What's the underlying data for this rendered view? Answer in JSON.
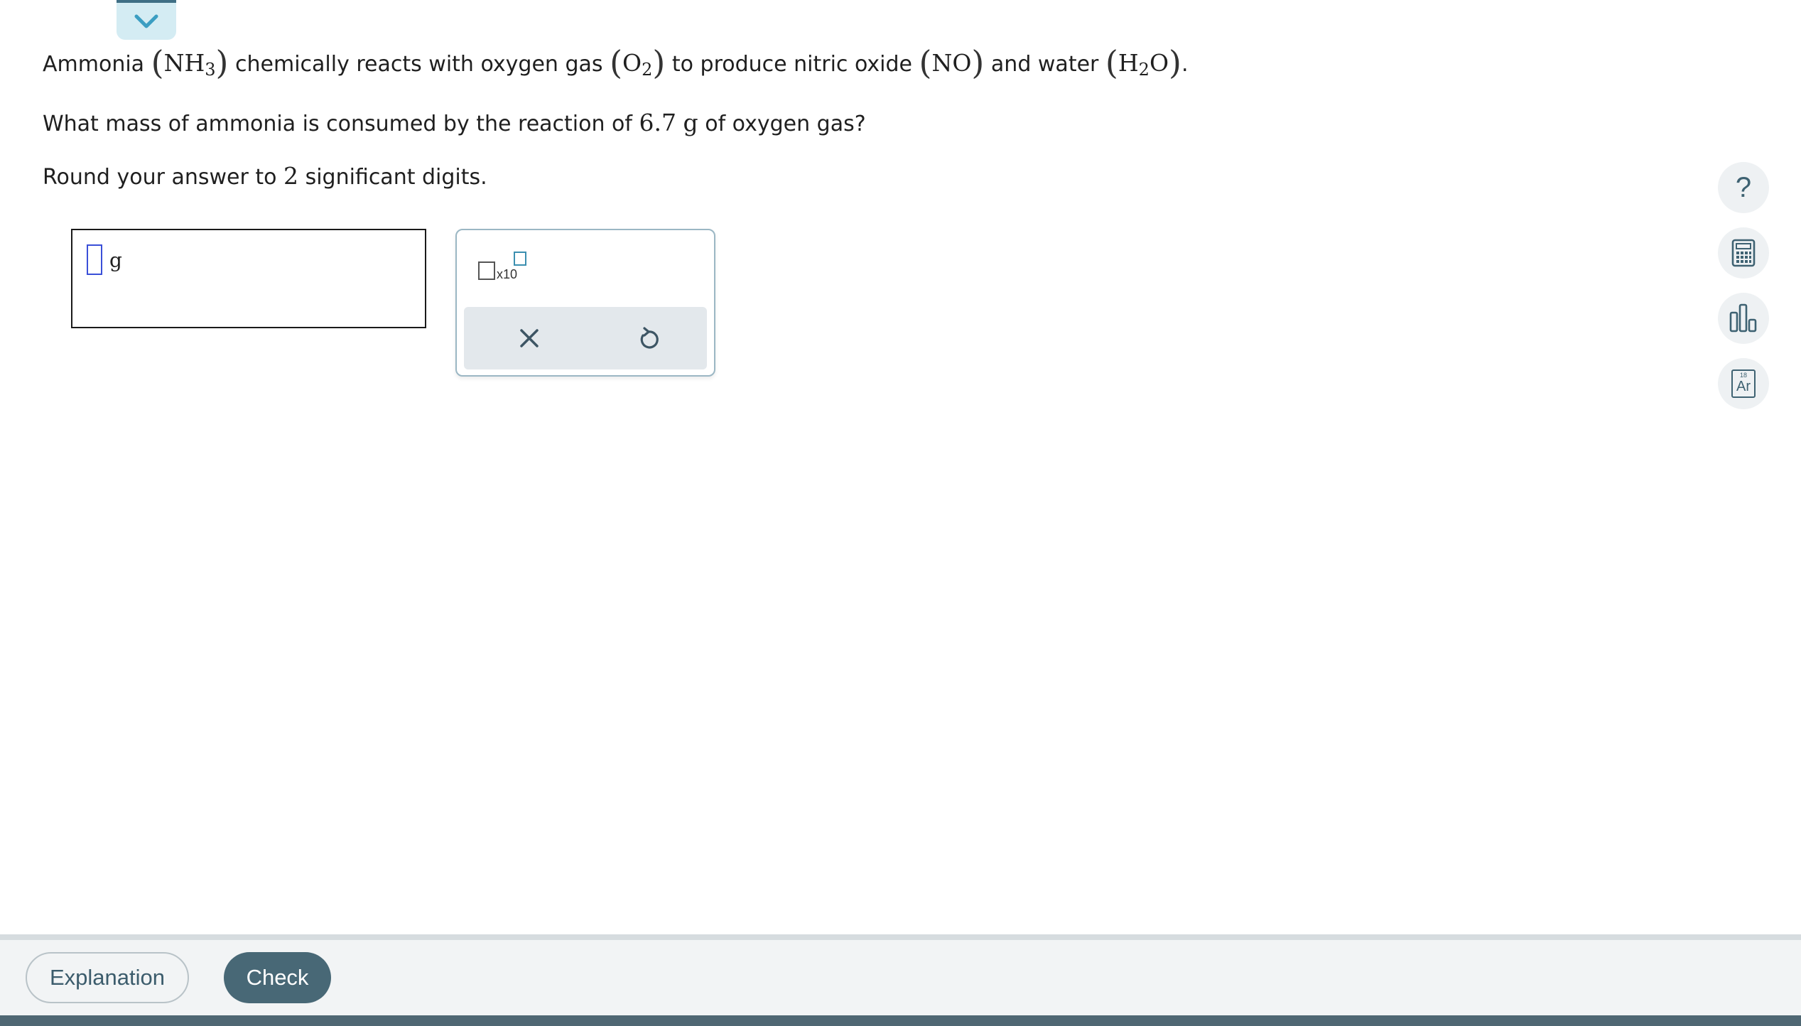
{
  "question": {
    "line1": {
      "t1": "Ammonia",
      "nh3_main": "NH",
      "nh3_sub": "3",
      "t2": "chemically reacts with oxygen gas",
      "o2_main": "O",
      "o2_sub": "2",
      "t3": "to produce nitric oxide",
      "no": "NO",
      "t4": "and water",
      "h2o_a": "H",
      "h2o_sub": "2",
      "h2o_b": "O",
      "period": "."
    },
    "line2": {
      "t1": "What mass of ammonia is consumed by the reaction of",
      "value": "6.7",
      "unit": "g",
      "t2": "of oxygen gas?"
    },
    "line3": {
      "t1": "Round your answer to",
      "digits": "2",
      "t2": "significant digits."
    }
  },
  "answer": {
    "value": "",
    "unit": "g"
  },
  "keypad": {
    "sci_label": "x10",
    "clear_icon": "close-icon",
    "undo_icon": "undo-icon"
  },
  "tools": [
    "help-icon",
    "calculator-icon",
    "data-chart-icon",
    "periodic-table-icon"
  ],
  "tools_labels": {
    "help": "?",
    "periodic_number": "18",
    "periodic_symbol": "Ar"
  },
  "footer": {
    "explanation_label": "Explanation",
    "check_label": "Check"
  },
  "colors": {
    "accent": "#486876",
    "cursor": "#3a4fd8",
    "tab_bg": "#d4ecf3"
  }
}
